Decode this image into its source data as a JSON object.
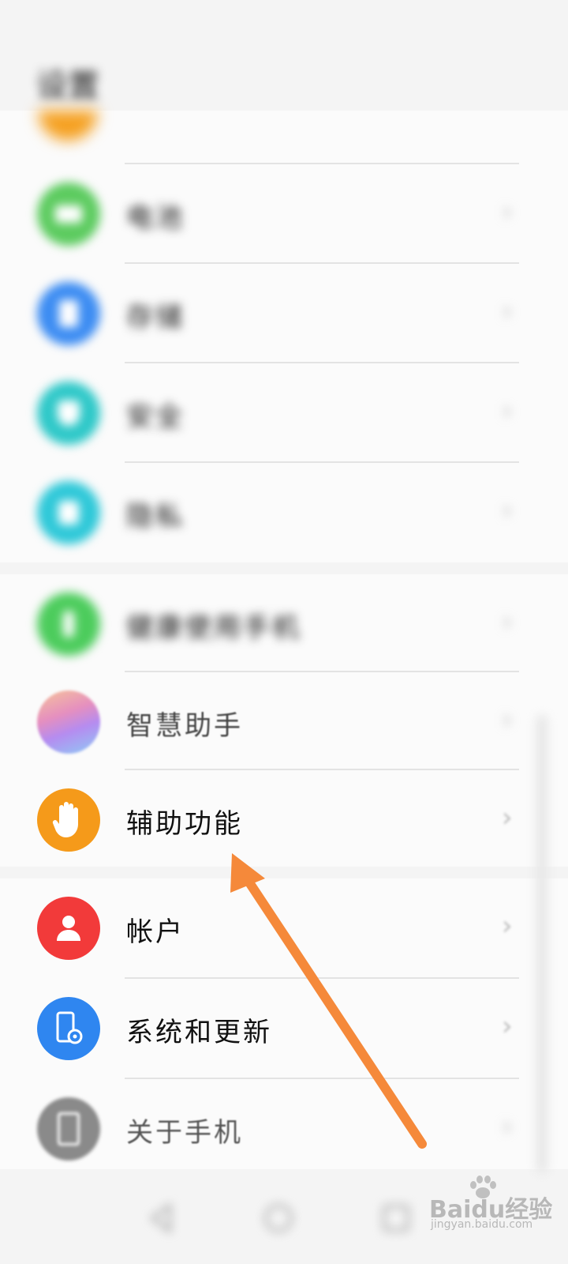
{
  "status_bar": {
    "left_text": "",
    "right_text": ""
  },
  "page": {
    "title": "设置"
  },
  "settings": {
    "group_a": [
      {
        "label": "电池",
        "icon": "battery-icon",
        "color": "#5ccb5f"
      },
      {
        "label": "存储",
        "icon": "storage-icon",
        "color": "#3c8cf2"
      },
      {
        "label": "安全",
        "icon": "shield-icon",
        "color": "#2ec8c8"
      },
      {
        "label": "隐私",
        "icon": "privacy-icon",
        "color": "#2ec8d8"
      }
    ],
    "group_b": [
      {
        "label": "健康使用手机",
        "icon": "hourglass-icon",
        "color": "#4ccc5c"
      },
      {
        "label": "智慧助手",
        "icon": "smart-assistant-icon",
        "color": "#e0a0d8"
      },
      {
        "label": "辅助功能",
        "icon": "hand-icon",
        "color": "#f59a1a"
      }
    ],
    "group_c": [
      {
        "label": "帐户",
        "icon": "account-icon",
        "color": "#f23a3a"
      },
      {
        "label": "系统和更新",
        "icon": "system-update-icon",
        "color": "#2f86f0"
      },
      {
        "label": "关于手机",
        "icon": "phone-info-icon",
        "color": "#8a8a8a"
      }
    ]
  },
  "chevron": "›",
  "annotation": {
    "color": "#f5893a"
  },
  "watermark": {
    "text": "Baidu经验",
    "subtext": "jingyan.baidu.com"
  }
}
